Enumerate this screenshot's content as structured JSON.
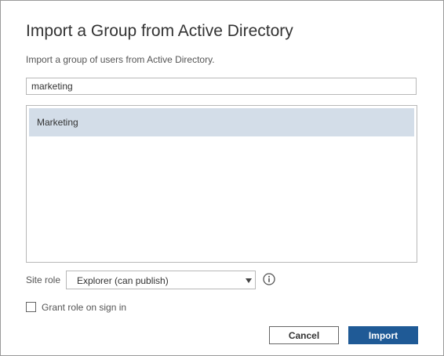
{
  "dialog": {
    "title": "Import a Group from Active Directory",
    "subtitle": "Import a group of users from Active Directory.",
    "search": {
      "value": "marketing",
      "placeholder": ""
    },
    "results": [
      {
        "label": "Marketing",
        "selected": true
      }
    ],
    "site_role": {
      "label": "Site role",
      "value": "Explorer (can publish)"
    },
    "grant_role": {
      "label": "Grant role on sign in",
      "checked": false
    },
    "buttons": {
      "cancel_label": "Cancel",
      "import_label": "Import"
    }
  },
  "colors": {
    "primary_button": "#1f5a96",
    "selected_row": "#d3dde8"
  },
  "icons": {
    "info": "info-icon",
    "dropdown": "chevron-down-icon"
  }
}
